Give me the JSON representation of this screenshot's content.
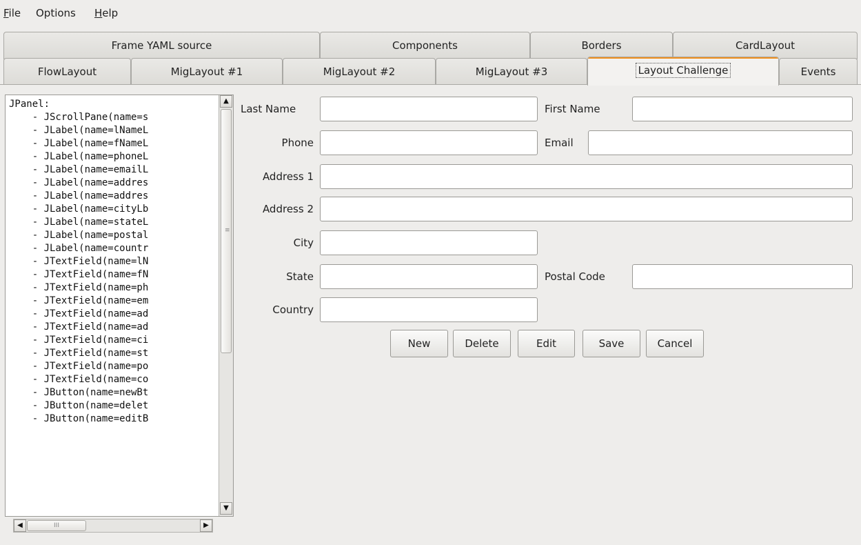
{
  "menubar": {
    "file": {
      "mnemonic": "F",
      "rest": "ile"
    },
    "options": "Options",
    "help": {
      "mnemonic": "H",
      "rest": "elp"
    }
  },
  "tabs": {
    "row1": [
      "Frame YAML source",
      "Components",
      "Borders",
      "CardLayout"
    ],
    "row2": [
      "FlowLayout",
      "MigLayout #1",
      "MigLayout #2",
      "MigLayout #3",
      "Layout Challenge",
      "Events"
    ],
    "selected": "Layout Challenge",
    "accent_color": "#f0901e"
  },
  "yaml_source": {
    "lines": [
      "JPanel:",
      "    - JScrollPane(name=s",
      "    - JLabel(name=lNameL",
      "    - JLabel(name=fNameL",
      "    - JLabel(name=phoneL",
      "    - JLabel(name=emailL",
      "    - JLabel(name=addres",
      "    - JLabel(name=addres",
      "    - JLabel(name=cityLb",
      "    - JLabel(name=stateL",
      "    - JLabel(name=postal",
      "    - JLabel(name=countr",
      "    - JTextField(name=lN",
      "    - JTextField(name=fN",
      "    - JTextField(name=ph",
      "    - JTextField(name=em",
      "    - JTextField(name=ad",
      "    - JTextField(name=ad",
      "    - JTextField(name=ci",
      "    - JTextField(name=st",
      "    - JTextField(name=po",
      "    - JTextField(name=co",
      "    - JButton(name=newBt",
      "    - JButton(name=delet",
      "    - JButton(name=editB"
    ]
  },
  "form": {
    "last_name_label": "Last Name",
    "first_name_label": "First Name",
    "phone_label": "Phone",
    "email_label": "Email",
    "address1_label": "Address 1",
    "address2_label": "Address 2",
    "city_label": "City",
    "state_label": "State",
    "postal_code_label": "Postal Code",
    "country_label": "Country",
    "values": {
      "last_name": "",
      "first_name": "",
      "phone": "",
      "email": "",
      "address1": "",
      "address2": "",
      "city": "",
      "state": "",
      "postal_code": "",
      "country": ""
    }
  },
  "buttons": {
    "new": "New",
    "delete": "Delete",
    "edit": "Edit",
    "save": "Save",
    "cancel": "Cancel"
  },
  "icons": {
    "scroll_up": "▲",
    "scroll_down": "▼",
    "scroll_left": "◀",
    "scroll_right": "▶",
    "vgrip": "≡",
    "hgrip": "III"
  }
}
